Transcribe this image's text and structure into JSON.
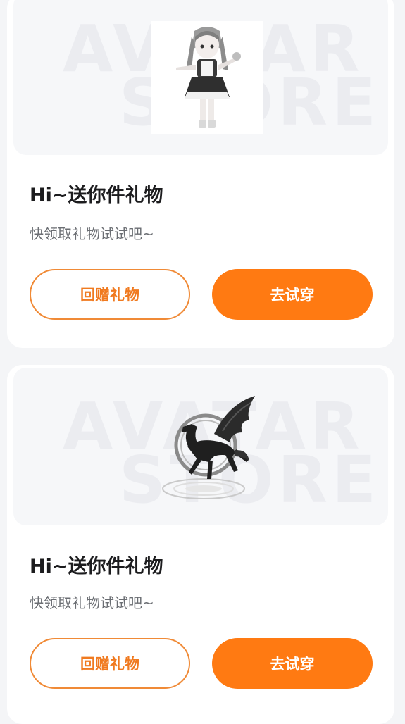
{
  "gifts": [
    {
      "watermark_line1": "AVATAR",
      "watermark_line2": "STORE",
      "item_icon": "doll-figure-icon",
      "title": "Hi~送你件礼物",
      "subtitle": "快领取礼物试试吧~",
      "return_label": "回赠礼物",
      "try_label": "去试穿"
    },
    {
      "watermark_line1": "AVATAR",
      "watermark_line2": "STORE",
      "item_icon": "winged-horse-icon",
      "title": "Hi~送你件礼物",
      "subtitle": "快领取礼物试试吧~",
      "return_label": "回赠礼物",
      "try_label": "去试穿"
    }
  ],
  "colors": {
    "accent": "#ff7a12",
    "outline": "#f08a36",
    "background": "#f4f5f7"
  }
}
